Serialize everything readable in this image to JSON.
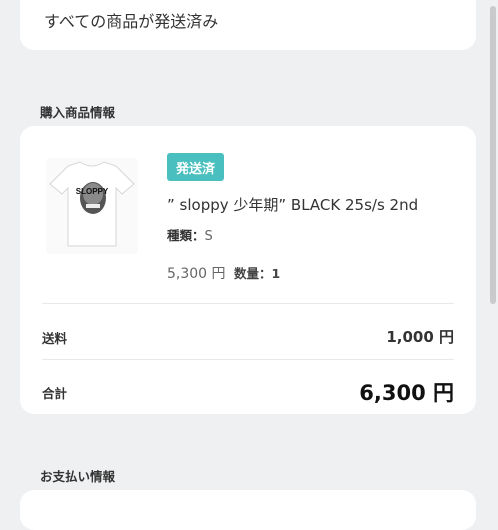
{
  "status_banner": {
    "text": "すべての商品が発送済み"
  },
  "purchase_section": {
    "title": "購入商品情報",
    "item": {
      "badge": "発送済",
      "name": "” sloppy 少年期” BLACK 25s/s 2nd",
      "variant_key": "種類：",
      "variant_value": "S",
      "price": "5,300 円",
      "quantity": "数量：1",
      "thumbnail_text": "SLOPPY"
    },
    "shipping_label": "送料",
    "shipping_value": "1,000 円",
    "total_label": "合計",
    "total_value": "6,300 円"
  },
  "payment_section": {
    "title": "お支払い情報"
  },
  "colors": {
    "accent": "#49bfc0",
    "background": "#eef0f2",
    "card": "#ffffff"
  }
}
